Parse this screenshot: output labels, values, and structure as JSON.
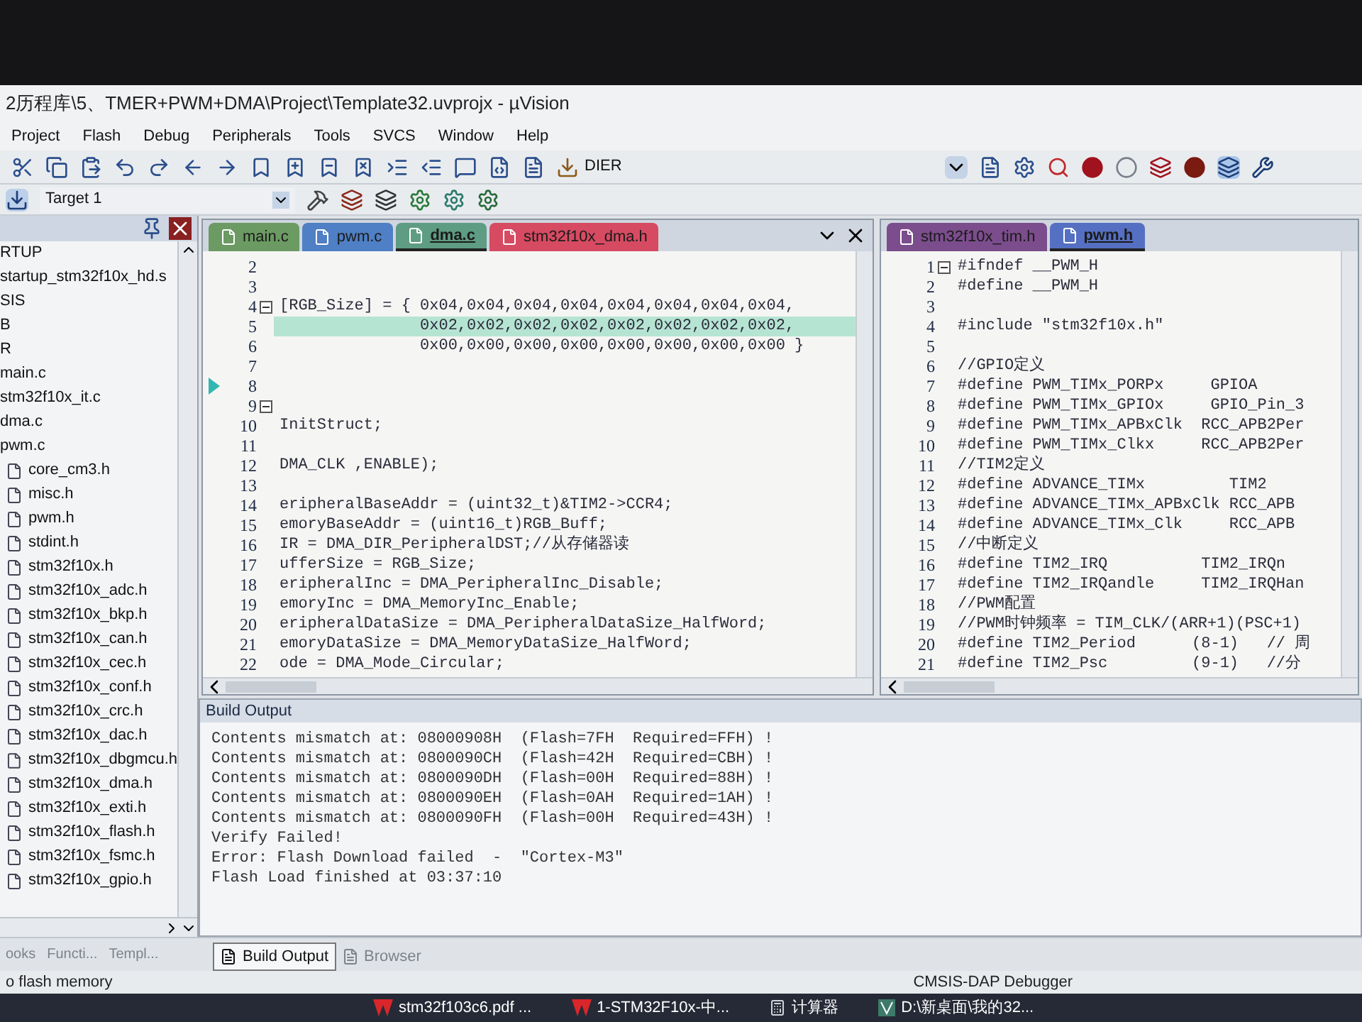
{
  "window": {
    "title": "2历程库\\5、TMER+PWM+DMA\\Project\\Template32.uvprojx - µVision"
  },
  "menu": [
    "Project",
    "Flash",
    "Debug",
    "Peripherals",
    "Tools",
    "SVCS",
    "Window",
    "Help"
  ],
  "toolbar": {
    "find_field": "DIER",
    "target": "Target 1"
  },
  "project_panel": {
    "items": [
      {
        "label": "RTUP",
        "kind": "group"
      },
      {
        "label": "startup_stm32f10x_hd.s",
        "kind": "group"
      },
      {
        "label": "SIS",
        "kind": "group"
      },
      {
        "label": "B",
        "kind": "group"
      },
      {
        "label": "R",
        "kind": "group"
      },
      {
        "label": "main.c",
        "kind": "group"
      },
      {
        "label": "stm32f10x_it.c",
        "kind": "group"
      },
      {
        "label": "dma.c",
        "kind": "group"
      },
      {
        "label": "pwm.c",
        "kind": "group"
      },
      {
        "label": "core_cm3.h",
        "kind": "file"
      },
      {
        "label": "misc.h",
        "kind": "file"
      },
      {
        "label": "pwm.h",
        "kind": "file"
      },
      {
        "label": "stdint.h",
        "kind": "file"
      },
      {
        "label": "stm32f10x.h",
        "kind": "file"
      },
      {
        "label": "stm32f10x_adc.h",
        "kind": "file"
      },
      {
        "label": "stm32f10x_bkp.h",
        "kind": "file"
      },
      {
        "label": "stm32f10x_can.h",
        "kind": "file"
      },
      {
        "label": "stm32f10x_cec.h",
        "kind": "file"
      },
      {
        "label": "stm32f10x_conf.h",
        "kind": "file"
      },
      {
        "label": "stm32f10x_crc.h",
        "kind": "file"
      },
      {
        "label": "stm32f10x_dac.h",
        "kind": "file"
      },
      {
        "label": "stm32f10x_dbgmcu.h",
        "kind": "file"
      },
      {
        "label": "stm32f10x_dma.h",
        "kind": "file"
      },
      {
        "label": "stm32f10x_exti.h",
        "kind": "file"
      },
      {
        "label": "stm32f10x_flash.h",
        "kind": "file"
      },
      {
        "label": "stm32f10x_fsmc.h",
        "kind": "file"
      },
      {
        "label": "stm32f10x_gpio.h",
        "kind": "file"
      }
    ],
    "tabs": [
      {
        "label": "ooks",
        "selected": false
      },
      {
        "label": "Functi...",
        "selected": false
      },
      {
        "label": "Templ...",
        "selected": false
      }
    ]
  },
  "left_editor": {
    "tabs": [
      {
        "label": "main.c",
        "color": "#6b9a62",
        "selected": false
      },
      {
        "label": "pwm.c",
        "color": "#4f7fc4",
        "selected": false
      },
      {
        "label": "dma.c",
        "color": "#5e9c84",
        "selected": true
      },
      {
        "label": "stm32f10x_dma.h",
        "color": "#d64b62",
        "selected": false
      }
    ],
    "lines": [
      {
        "n": "2",
        "fold": false,
        "highlighted": false,
        "current": false
      },
      {
        "n": "3",
        "fold": false,
        "highlighted": false,
        "current": false
      },
      {
        "n": "4",
        "text": "[RGB_Size] = { 0x04,0x04,0x04,0x04,0x04,0x04,0x04,0x04,",
        "fold": true,
        "highlighted": false,
        "current": false
      },
      {
        "n": "5",
        "text": "               0x02,0x02,0x02,0x02,0x02,0x02,0x02,0x02,",
        "fold": false,
        "highlighted": true,
        "current": false
      },
      {
        "n": "6",
        "text": "               0x00,0x00,0x00,0x00,0x00,0x00,0x00,0x00 }",
        "fold": false,
        "highlighted": false,
        "current": false
      },
      {
        "n": "7",
        "fold": false,
        "highlighted": false,
        "current": false
      },
      {
        "n": "8",
        "fold": false,
        "highlighted": false,
        "current": true
      },
      {
        "n": "9",
        "fold": true,
        "highlighted": false,
        "current": false
      },
      {
        "n": "10",
        "text": "InitStruct;",
        "fold": false,
        "highlighted": false,
        "current": false
      },
      {
        "n": "11",
        "fold": false,
        "highlighted": false,
        "current": false
      },
      {
        "n": "12",
        "text": "DMA_CLK ,ENABLE);",
        "fold": false,
        "highlighted": false,
        "current": false
      },
      {
        "n": "13",
        "fold": false,
        "highlighted": false,
        "current": false
      },
      {
        "n": "14",
        "text": "eripheralBaseAddr = (uint32_t)&TIM2->CCR4;",
        "fold": false,
        "highlighted": false,
        "current": false
      },
      {
        "n": "15",
        "text": "emoryBaseAddr = (uint16_t)RGB_Buff;",
        "fold": false,
        "highlighted": false,
        "current": false
      },
      {
        "n": "16",
        "text": "IR = DMA_DIR_PeripheralDST;//从存储器读",
        "fold": false,
        "highlighted": false,
        "current": false
      },
      {
        "n": "17",
        "text": "ufferSize = RGB_Size;",
        "fold": false,
        "highlighted": false,
        "current": false
      },
      {
        "n": "18",
        "text": "eripheralInc = DMA_PeripheralInc_Disable;",
        "fold": false,
        "highlighted": false,
        "current": false
      },
      {
        "n": "19",
        "text": "emoryInc = DMA_MemoryInc_Enable;",
        "fold": false,
        "highlighted": false,
        "current": false
      },
      {
        "n": "20",
        "text": "eripheralDataSize = DMA_PeripheralDataSize_HalfWord;",
        "fold": false,
        "highlighted": false,
        "current": false
      },
      {
        "n": "21",
        "text": "emoryDataSize = DMA_MemoryDataSize_HalfWord;",
        "fold": false,
        "highlighted": false,
        "current": false
      },
      {
        "n": "22",
        "text": "ode = DMA_Mode_Circular;",
        "fold": false,
        "highlighted": false,
        "current": false
      }
    ]
  },
  "right_editor": {
    "tabs": [
      {
        "label": "stm32f10x_tim.h",
        "color": "#7b4d8c",
        "selected": false
      },
      {
        "label": "pwm.h",
        "color": "#5570c2",
        "selected": true
      }
    ],
    "lines": [
      {
        "n": "1",
        "text": "#ifndef __PWM_H",
        "fold": true,
        "highlighted": false,
        "current": false
      },
      {
        "n": "2",
        "text": "#define __PWM_H",
        "fold": false,
        "highlighted": false,
        "current": false
      },
      {
        "n": "3",
        "fold": false,
        "highlighted": false,
        "current": false
      },
      {
        "n": "4",
        "text": "#include \"stm32f10x.h\"",
        "fold": false,
        "highlighted": false,
        "current": false
      },
      {
        "n": "5",
        "fold": false,
        "highlighted": false,
        "current": false
      },
      {
        "n": "6",
        "text": "//GPIO定义",
        "fold": false,
        "highlighted": false,
        "current": false
      },
      {
        "n": "7",
        "text": "#define PWM_TIMx_PORPx     GPIOA",
        "fold": false,
        "highlighted": false,
        "current": false
      },
      {
        "n": "8",
        "text": "#define PWM_TIMx_GPIOx     GPIO_Pin_3",
        "fold": false,
        "highlighted": false,
        "current": false
      },
      {
        "n": "9",
        "text": "#define PWM_TIMx_APBxClk  RCC_APB2Per",
        "fold": false,
        "highlighted": false,
        "current": false
      },
      {
        "n": "10",
        "text": "#define PWM_TIMx_Clkx     RCC_APB2Per",
        "fold": false,
        "highlighted": false,
        "current": false
      },
      {
        "n": "11",
        "text": "//TIM2定义",
        "fold": false,
        "highlighted": false,
        "current": false
      },
      {
        "n": "12",
        "text": "#define ADVANCE_TIMx         TIM2",
        "fold": false,
        "highlighted": false,
        "current": false
      },
      {
        "n": "13",
        "text": "#define ADVANCE_TIMx_APBxClk RCC_APB",
        "fold": false,
        "highlighted": false,
        "current": false
      },
      {
        "n": "14",
        "text": "#define ADVANCE_TIMx_Clk     RCC_APB",
        "fold": false,
        "highlighted": false,
        "current": false
      },
      {
        "n": "15",
        "text": "//中断定义",
        "fold": false,
        "highlighted": false,
        "current": false
      },
      {
        "n": "16",
        "text": "#define TIM2_IRQ          TIM2_IRQn",
        "fold": false,
        "highlighted": false,
        "current": false
      },
      {
        "n": "17",
        "text": "#define TIM2_IRQandle     TIM2_IRQHan",
        "fold": false,
        "highlighted": false,
        "current": false
      },
      {
        "n": "18",
        "text": "//PWM配置",
        "fold": false,
        "highlighted": false,
        "current": false
      },
      {
        "n": "19",
        "text": "//PWM时钟频率 = TIM_CLK/(ARR+1)(PSC+1)",
        "fold": false,
        "highlighted": false,
        "current": false
      },
      {
        "n": "20",
        "text": "#define TIM2_Period      (8-1)   // 周",
        "fold": false,
        "highlighted": false,
        "current": false
      },
      {
        "n": "21",
        "text": "#define TIM2_Psc         (9-1)   //分",
        "fold": false,
        "highlighted": false,
        "current": false
      }
    ]
  },
  "build_output": {
    "title": "Build Output",
    "lines": [
      "Contents mismatch at: 08000908H  (Flash=7FH  Required=FFH) !",
      "Contents mismatch at: 0800090CH  (Flash=42H  Required=CBH) !",
      "Contents mismatch at: 0800090DH  (Flash=00H  Required=88H) !",
      "Contents mismatch at: 0800090EH  (Flash=0AH  Required=1AH) !",
      "Contents mismatch at: 0800090FH  (Flash=00H  Required=43H) !",
      "Verify Failed!",
      "Error: Flash Download failed  -  \"Cortex-M3\"",
      "Flash Load finished at 03:37:10"
    ],
    "tabs": [
      {
        "label": "Build Output",
        "selected": true
      },
      {
        "label": "Browser",
        "selected": false
      }
    ]
  },
  "status_bar": {
    "message": "o flash memory",
    "debugger": "CMSIS-DAP Debugger"
  },
  "taskbar": [
    {
      "label": "stm32f103c6.pdf ...",
      "kind": "pdf"
    },
    {
      "label": "1-STM32F10x-中...",
      "kind": "pdf"
    },
    {
      "label": "计算器",
      "kind": "calculator"
    },
    {
      "label": "D:\\新桌面\\我的32...",
      "kind": "keil"
    }
  ]
}
